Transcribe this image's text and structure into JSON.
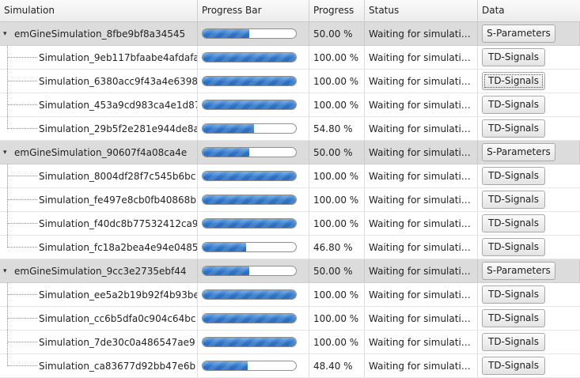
{
  "columns": {
    "simulation": "Simulation",
    "progress_bar": "Progress Bar",
    "progress": "Progress",
    "status": "Status",
    "data": "Data"
  },
  "colors": {
    "bar_fill": "#2f74c8",
    "group_row_bg": "#dcdcdc"
  },
  "groups": [
    {
      "name": "emGineSimulation_8fbe9bf8a34545",
      "progress_fraction": 0.5,
      "progress": "50.00 %",
      "status": "Waiting for simulation...",
      "data_button": "S-Parameters",
      "expanded": true,
      "children": [
        {
          "name": "Simulation_9eb117bfaabe4afdafa",
          "progress_fraction": 1.0,
          "progress": "100.00 %",
          "status": "Waiting for simulation...",
          "data_button": "TD-Signals"
        },
        {
          "name": "Simulation_6380acc9f43a4e6398",
          "progress_fraction": 1.0,
          "progress": "100.00 %",
          "status": "Waiting for simulation...",
          "data_button": "TD-Signals",
          "focused": true
        },
        {
          "name": "Simulation_453a9cd983ca4e1d87",
          "progress_fraction": 1.0,
          "progress": "100.00 %",
          "status": "Waiting for simulation...",
          "data_button": "TD-Signals"
        },
        {
          "name": "Simulation_29b5f2e281e944de8a",
          "progress_fraction": 0.548,
          "progress": "54.80 %",
          "status": "Waiting for simulation...",
          "data_button": "TD-Signals"
        }
      ]
    },
    {
      "name": "emGineSimulation_90607f4a08ca4e",
      "progress_fraction": 0.5,
      "progress": "50.00 %",
      "status": "Waiting for simulation...",
      "data_button": "S-Parameters",
      "expanded": true,
      "children": [
        {
          "name": "Simulation_8004df28f7c545b6bc",
          "progress_fraction": 1.0,
          "progress": "100.00 %",
          "status": "Waiting for simulation...",
          "data_button": "TD-Signals"
        },
        {
          "name": "Simulation_fe497e8cb0fb40868b",
          "progress_fraction": 1.0,
          "progress": "100.00 %",
          "status": "Waiting for simulation...",
          "data_button": "TD-Signals"
        },
        {
          "name": "Simulation_f40dc8b77532412ca9",
          "progress_fraction": 1.0,
          "progress": "100.00 %",
          "status": "Waiting for simulation...",
          "data_button": "TD-Signals"
        },
        {
          "name": "Simulation_fc18a2bea4e94e0485",
          "progress_fraction": 0.468,
          "progress": "46.80 %",
          "status": "Waiting for simulation...",
          "data_button": "TD-Signals"
        }
      ]
    },
    {
      "name": "emGineSimulation_9cc3e2735ebf44",
      "progress_fraction": 0.5,
      "progress": "50.00 %",
      "status": "Waiting for simulation...",
      "data_button": "S-Parameters",
      "expanded": true,
      "children": [
        {
          "name": "Simulation_ee5a2b19b92f4b93be",
          "progress_fraction": 1.0,
          "progress": "100.00 %",
          "status": "Waiting for simulation...",
          "data_button": "TD-Signals"
        },
        {
          "name": "Simulation_cc6b5dfa0c904c64bc",
          "progress_fraction": 1.0,
          "progress": "100.00 %",
          "status": "Waiting for simulation...",
          "data_button": "TD-Signals"
        },
        {
          "name": "Simulation_7de30c0a486547ae9",
          "progress_fraction": 1.0,
          "progress": "100.00 %",
          "status": "Waiting for simulation...",
          "data_button": "TD-Signals"
        },
        {
          "name": "Simulation_ca83677d92bb47e6b",
          "progress_fraction": 0.484,
          "progress": "48.40 %",
          "status": "Waiting for simulation...",
          "data_button": "TD-Signals"
        }
      ]
    }
  ]
}
